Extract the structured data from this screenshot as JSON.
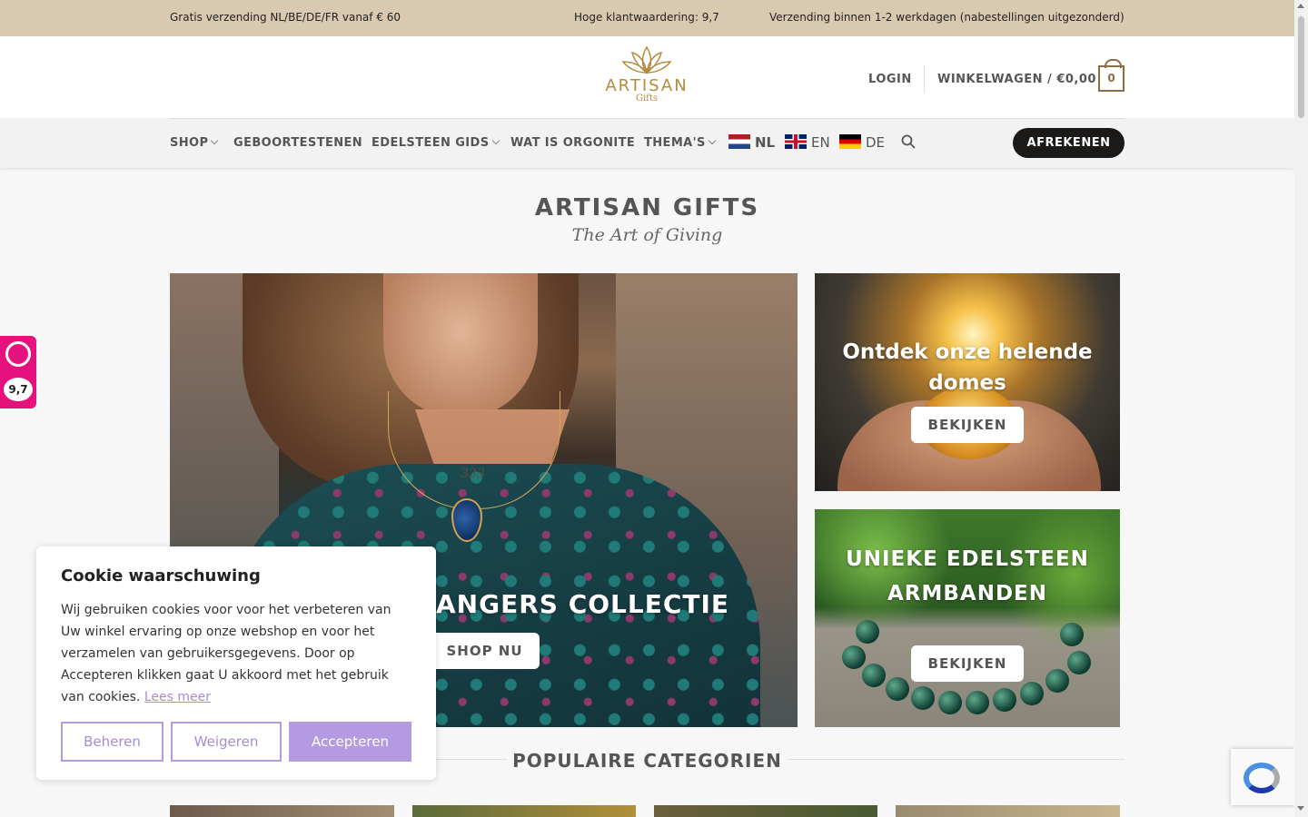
{
  "topbar": {
    "shipping": "Gratis verzending NL/BE/DE/FR vanaf € 60",
    "rating": "Hoge klantwaardering: 9,7",
    "delivery": "Verzending binnen 1-2 werkdagen (nabestellingen uitgezonderd)"
  },
  "header": {
    "logo_word": "ARTISAN",
    "logo_sub": "Gifts",
    "login": "LOGIN",
    "cart_label": "WINKELWAGEN / €0,00",
    "cart_count": "0"
  },
  "nav": {
    "items": [
      {
        "label": "SHOP",
        "dropdown": true
      },
      {
        "label": "GEBOORTESTENEN",
        "dropdown": false
      },
      {
        "label": "EDELSTEEN GIDS",
        "dropdown": true
      },
      {
        "label": "WAT IS ORGONITE",
        "dropdown": false
      },
      {
        "label": "THEMA'S",
        "dropdown": true
      }
    ],
    "languages": [
      {
        "code": "NL",
        "active": true,
        "icon": "flag-nl-icon"
      },
      {
        "code": "EN",
        "active": false,
        "icon": "flag-uk-icon"
      },
      {
        "code": "DE",
        "active": false,
        "icon": "flag-de-icon"
      }
    ],
    "search_icon": "search-icon",
    "checkout": "AFREKENEN"
  },
  "hero": {
    "title": "ARTISAN GIFTS",
    "tagline": "The Art of Giving"
  },
  "banners": {
    "main": {
      "title": "ANGERS COLLECTIE",
      "pendant_text": "333",
      "button": "SHOP NU"
    },
    "domes": {
      "title": "Ontdek onze helende domes",
      "button": "BEKIJKEN"
    },
    "bracelets": {
      "title": "UNIEKE EDELSTEEN ARMBANDEN",
      "button": "BEKIJKEN"
    }
  },
  "section": {
    "title": "POPULAIRE CATEGORIEN"
  },
  "rating_widget": {
    "score": "9,7",
    "icon": "kiyoh-icon"
  },
  "cookie": {
    "title": "Cookie waarschuwing",
    "text": "Wij gebruiken cookies voor voor het verbeteren van Uw winkel ervaring op onze webshop en voor het verzamelen van gebruikersgegevens. Door op Accepteren klikken gaat U akkoord met het gebruik van cookies.",
    "link": "Lees meer",
    "buttons": {
      "manage": "Beheren",
      "decline": "Weigeren",
      "accept": "Accepteren"
    }
  },
  "colors": {
    "topbar_bg": "#d9c9b0",
    "brand_gold": "#b48a3c",
    "checkout_bg": "#1c1a18",
    "cookie_accent": "#b49ae0",
    "rating_pink": "#e5127d"
  }
}
